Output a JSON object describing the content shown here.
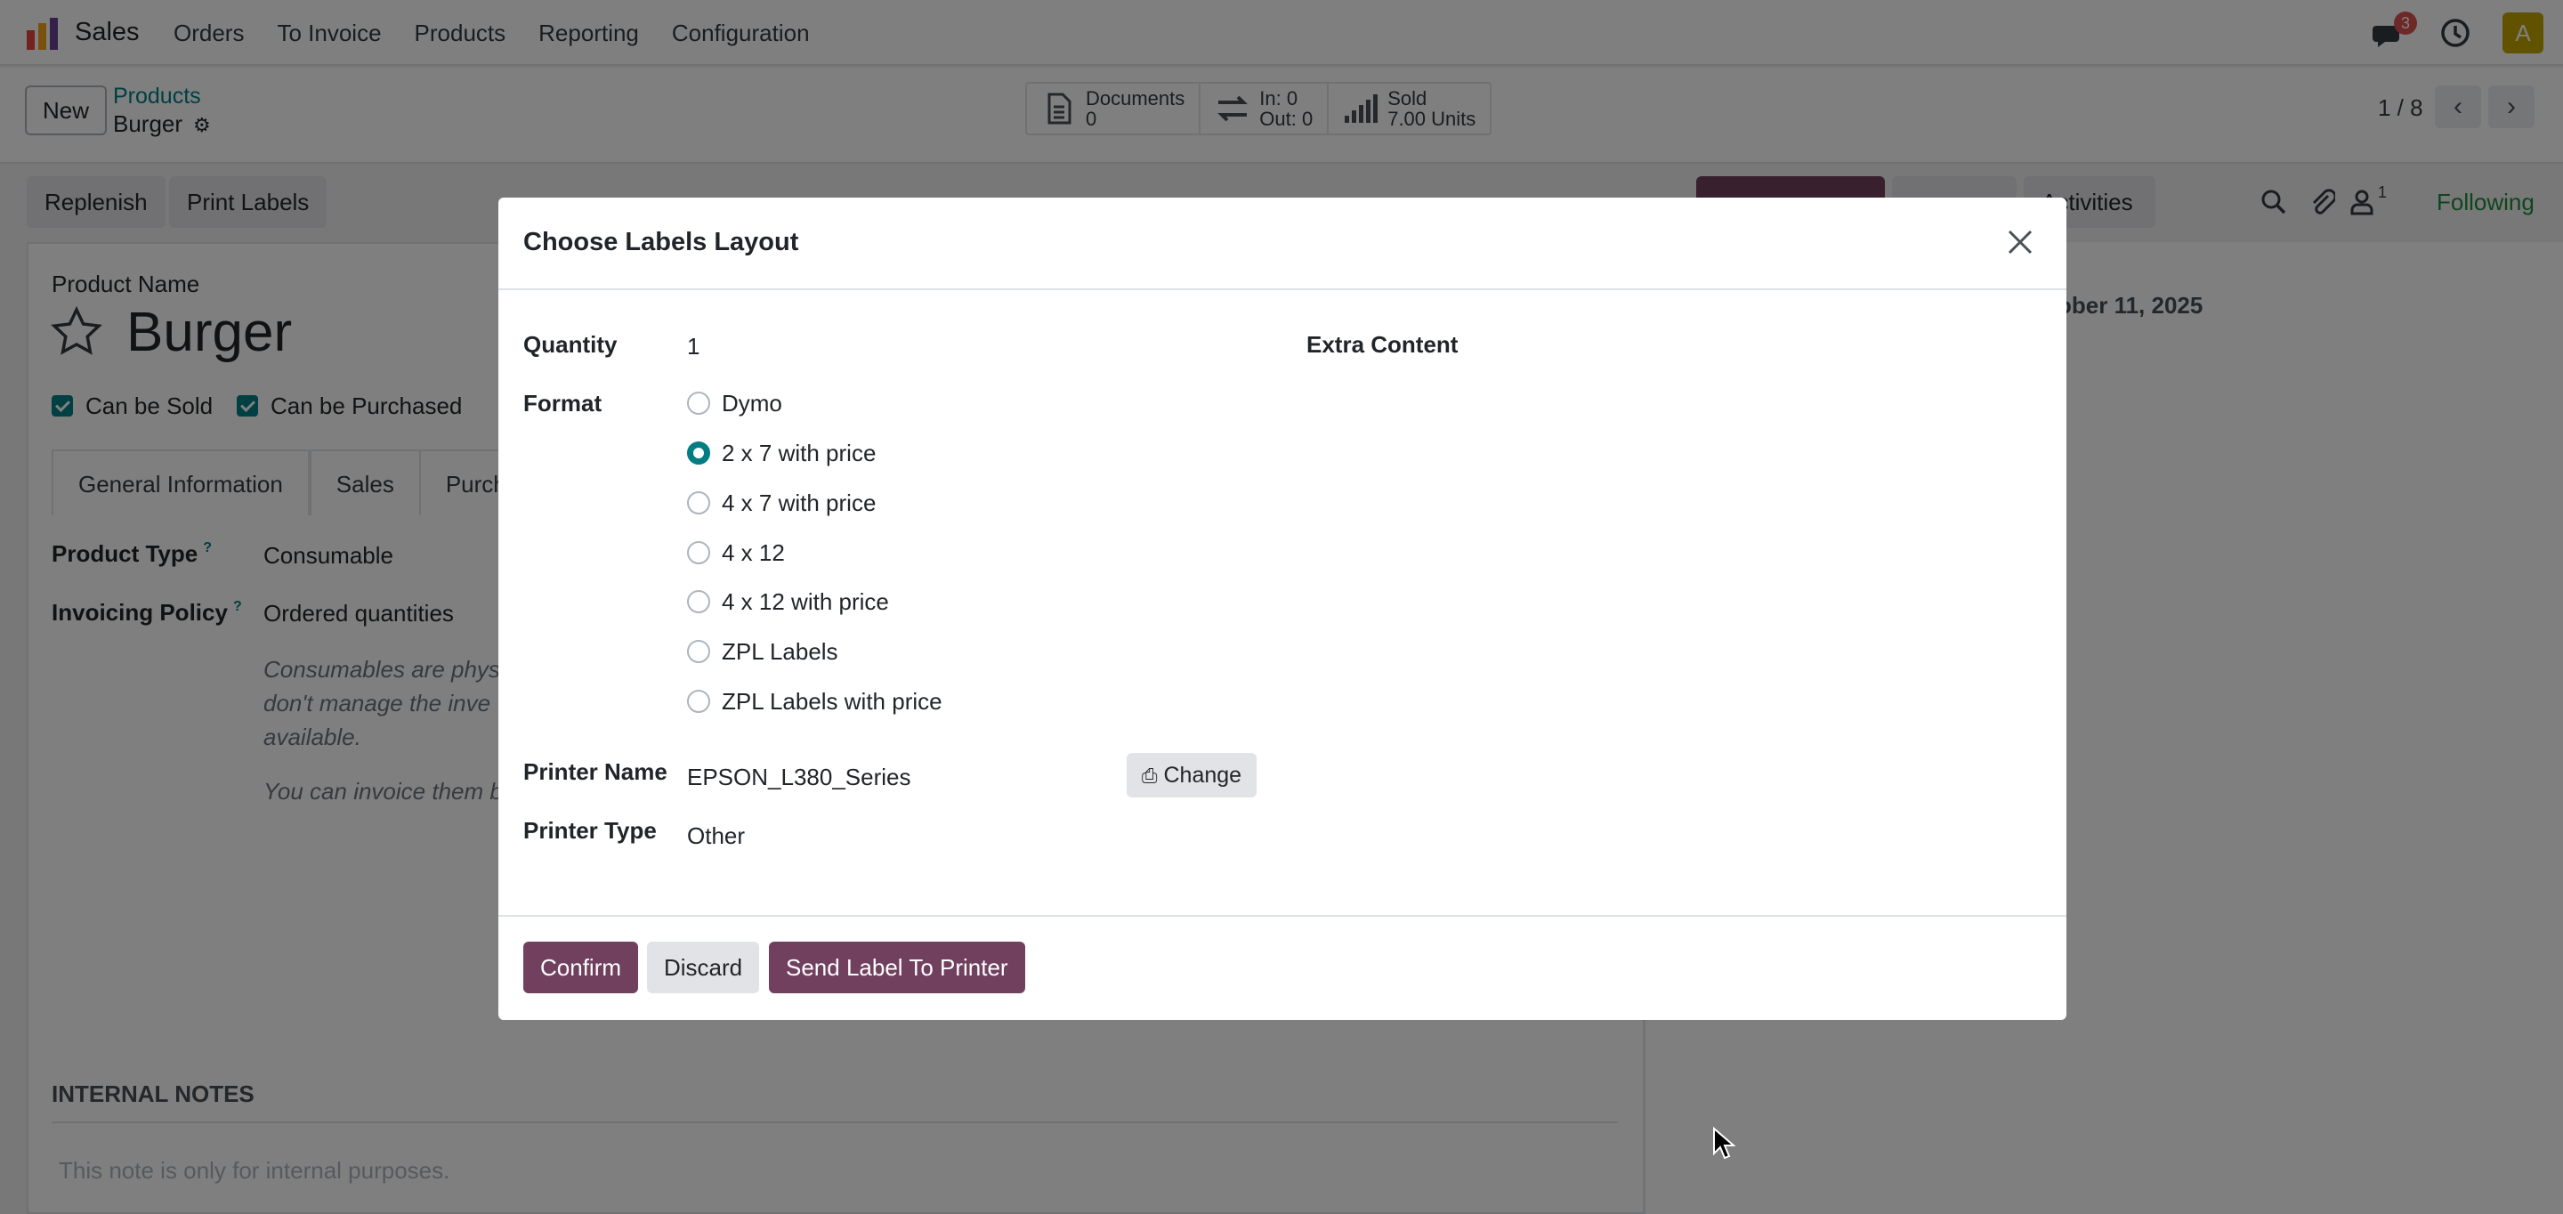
{
  "navbar": {
    "app_name": "Sales",
    "menu": [
      "Orders",
      "To Invoice",
      "Products",
      "Reporting",
      "Configuration"
    ],
    "chat_badge": "3",
    "avatar_letter": "A"
  },
  "control": {
    "new_label": "New",
    "breadcrumb_parent": "Products",
    "breadcrumb_current": "Burger",
    "stats": [
      {
        "line1": "Documents",
        "line2": "0",
        "icon": "document-icon"
      },
      {
        "line1": "In: 0",
        "line2": "Out: 0",
        "icon": "transfer-icon"
      },
      {
        "line1": "Sold",
        "line2": "7.00 Units",
        "icon": "signal-icon"
      }
    ],
    "pager": "1 / 8"
  },
  "actions": {
    "replenish": "Replenish",
    "print_labels": "Print Labels",
    "following": "Following",
    "follower_count": "1",
    "activities": "Activities"
  },
  "form": {
    "product_name_label": "Product Name",
    "product_name": "Burger",
    "can_be_sold": "Can be Sold",
    "can_be_purchased": "Can be Purchased",
    "tabs": [
      "General Information",
      "Sales",
      "Purch"
    ],
    "product_type_label": "Product Type",
    "product_type_value": "Consumable",
    "invoicing_policy_label": "Invoicing Policy",
    "invoicing_policy_value": "Ordered quantities",
    "help1_l1": "Consumables are phys",
    "help1_l2": "don't manage the inve",
    "help1_l3": "available.",
    "help2": "You can invoice them b",
    "internal_notes": "INTERNAL NOTES",
    "note_placeholder": "This note is only for internal purposes.",
    "date_fragment": "ober 11, 2025"
  },
  "modal": {
    "title": "Choose Labels Layout",
    "quantity_label": "Quantity",
    "quantity_value": "1",
    "extra_content_label": "Extra Content",
    "format_label": "Format",
    "format_options": [
      "Dymo",
      "2 x 7 with price",
      "4 x 7 with price",
      "4 x 12",
      "4 x 12 with price",
      "ZPL Labels",
      "ZPL Labels with price"
    ],
    "selected_format": "2 x 7 with price",
    "printer_name_label": "Printer Name",
    "printer_name_value": "EPSON_L380_Series",
    "change_label": "Change",
    "printer_type_label": "Printer Type",
    "printer_type_value": "Other",
    "confirm": "Confirm",
    "discard": "Discard",
    "send_to_printer": "Send Label To Printer"
  },
  "colors": {
    "primary": "#71405f",
    "accent_teal": "#017e84",
    "following_green": "#1f8b38"
  }
}
